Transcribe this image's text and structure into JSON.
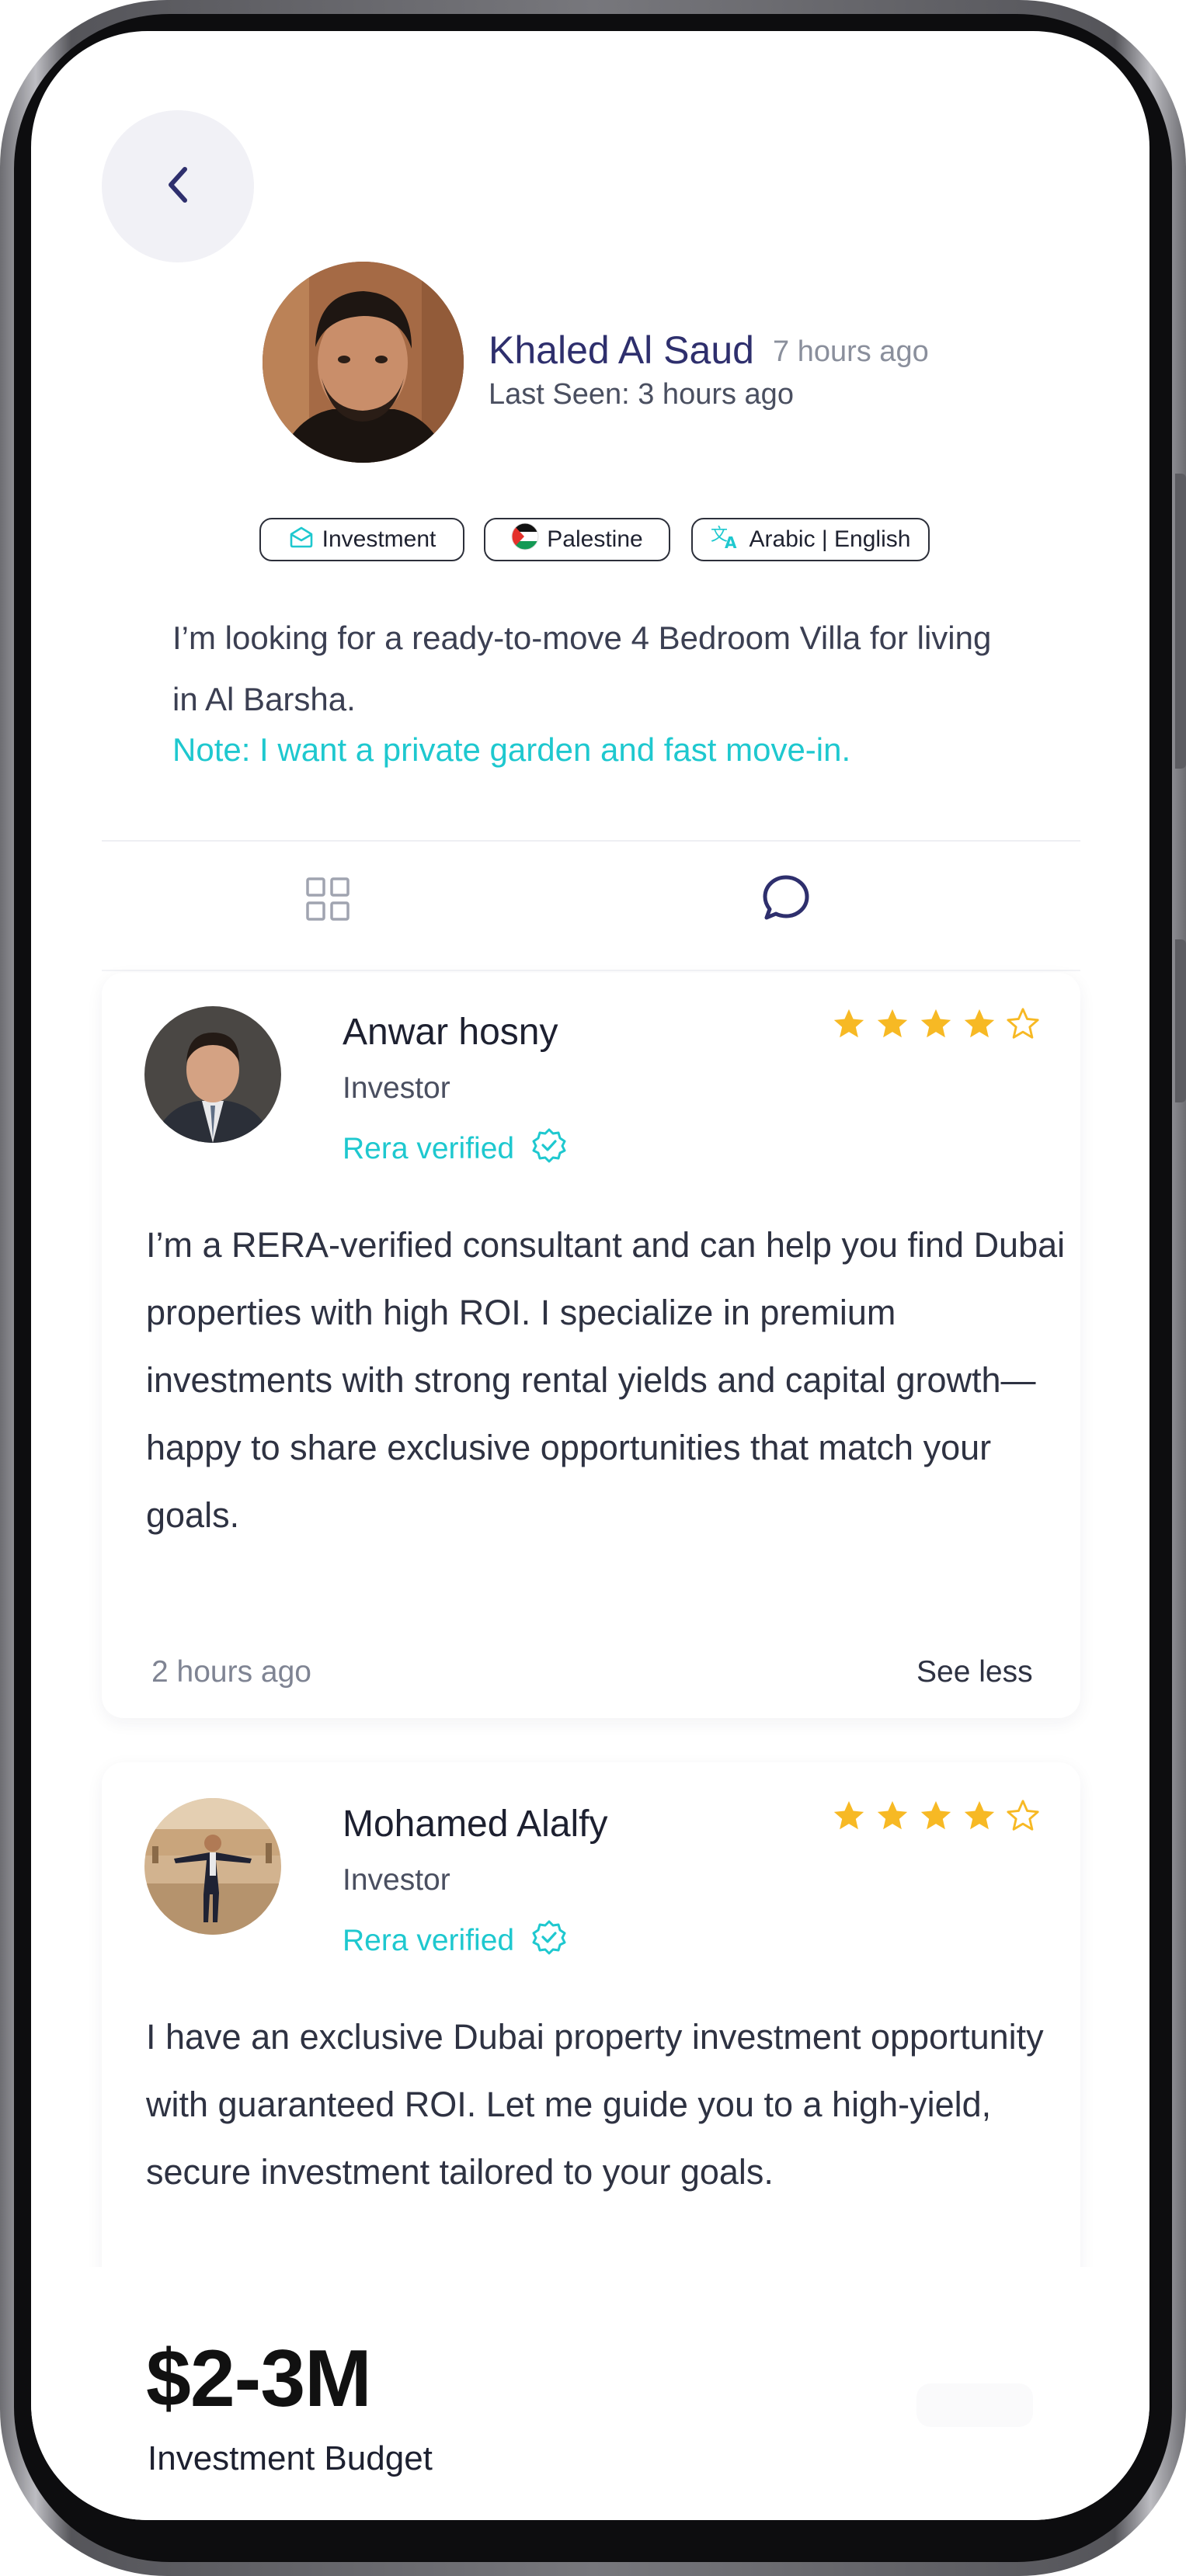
{
  "header": {
    "back_icon": "chevron-left-icon"
  },
  "profile": {
    "name": "Khaled Al Saud",
    "posted": "7 hours ago",
    "last_seen": "Last Seen: 3 hours ago",
    "tags": {
      "category": "Investment",
      "country": "Palestine",
      "languages": "Arabic | English"
    }
  },
  "request": {
    "text": "I’m looking for a ready-to-move 4 Bedroom Villa for living in Al Barsha.",
    "note": "Note: I want a private garden and fast move-in."
  },
  "tabs": {
    "grid_icon": "grid-icon",
    "chat_icon": "chat-bubble-icon",
    "active": "chat"
  },
  "reviews": [
    {
      "name": "Anwar hosny",
      "role": "Investor",
      "verified": "Rera verified",
      "rating": 4,
      "max_rating": 5,
      "body": "I’m a RERA-verified consultant and can help you find Dubai properties with high ROI. I specialize in premium investments with strong rental yields and capital growth—happy to share exclusive opportunities that match your goals.",
      "time": "2 hours ago",
      "toggle": "See less"
    },
    {
      "name": "Mohamed Alalfy",
      "role": "Investor",
      "verified": "Rera verified",
      "rating": 4,
      "max_rating": 5,
      "body": "I have an exclusive Dubai property investment opportunity with guaranteed ROI. Let me guide you to a high-yield, secure investment tailored to your goals."
    }
  ],
  "budget": {
    "value": "$2-3M",
    "label": "Investment Budget"
  },
  "colors": {
    "accent": "#1ec8cf",
    "name": "#2e2f6d",
    "star": "#f7b924"
  }
}
